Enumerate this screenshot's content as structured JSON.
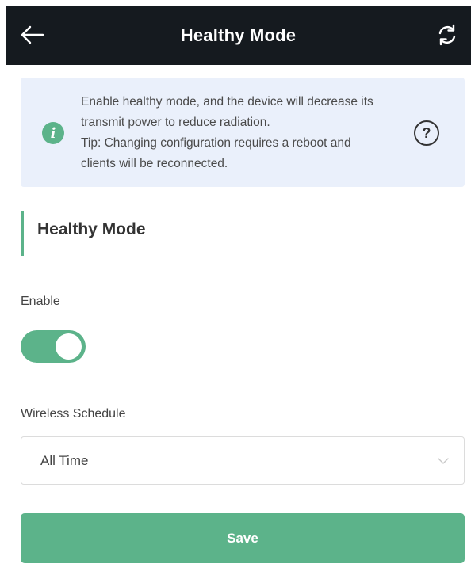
{
  "header": {
    "title": "Healthy Mode",
    "back_icon": "arrow-left-icon",
    "refresh_icon": "refresh-icon"
  },
  "info": {
    "line1": "Enable healthy mode, and the device will decrease its",
    "line2": "transmit power to reduce radiation.",
    "line3": "Tip: Changing configuration requires a reboot and",
    "line4": "clients will be reconnected.",
    "info_icon": "info-icon",
    "info_glyph": "i",
    "help_icon": "help-icon",
    "help_glyph": "?"
  },
  "section": {
    "title": "Healthy Mode"
  },
  "enable": {
    "label": "Enable",
    "on": true
  },
  "schedule": {
    "label": "Wireless Schedule",
    "selected": "All Time"
  },
  "actions": {
    "save_label": "Save"
  },
  "colors": {
    "accent": "#5cb38a",
    "header_bg": "#151a1f",
    "info_bg": "#eaf0fb"
  }
}
